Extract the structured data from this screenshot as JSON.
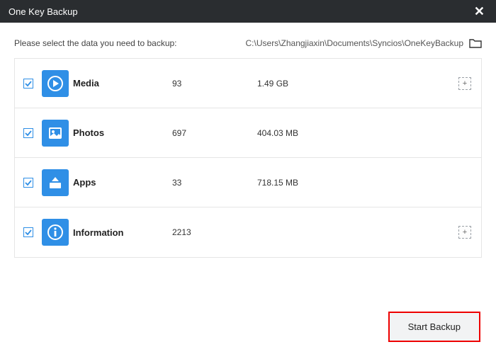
{
  "window": {
    "title": "One Key Backup",
    "close_label": "✕"
  },
  "header": {
    "instruction": "Please select the data you need to backup:",
    "path": "C:\\Users\\Zhangjiaxin\\Documents\\Syncios\\OneKeyBackup"
  },
  "categories": [
    {
      "key": "media",
      "label": "Media",
      "count": "93",
      "size": "1.49 GB",
      "checked": true,
      "expandable": true,
      "icon": "media-icon"
    },
    {
      "key": "photos",
      "label": "Photos",
      "count": "697",
      "size": "404.03 MB",
      "checked": true,
      "expandable": false,
      "icon": "photos-icon"
    },
    {
      "key": "apps",
      "label": "Apps",
      "count": "33",
      "size": "718.15 MB",
      "checked": true,
      "expandable": false,
      "icon": "apps-icon"
    },
    {
      "key": "information",
      "label": "Information",
      "count": "2213",
      "size": "",
      "checked": true,
      "expandable": true,
      "icon": "info-icon"
    }
  ],
  "footer": {
    "start_label": "Start Backup"
  },
  "colors": {
    "accent": "#2f8fe6",
    "titlebar": "#2a2d30",
    "highlight_border": "#e00"
  }
}
